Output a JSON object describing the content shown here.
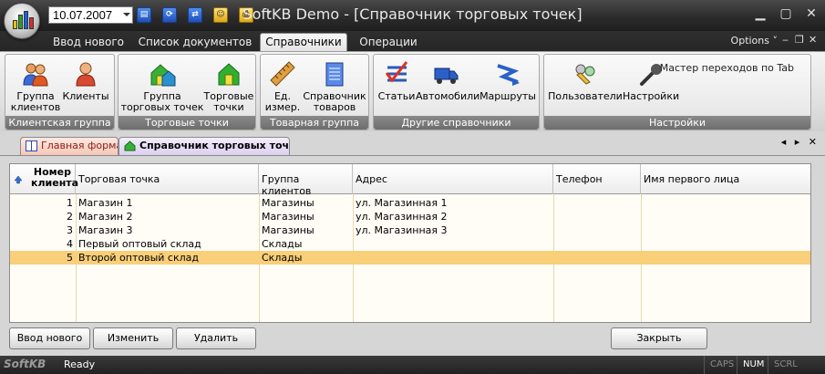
{
  "window": {
    "title": "SoftKB Demo - [Справочник торговых точек]",
    "date_value": "10.07.2007",
    "options_label": "Options",
    "options_chevron": "˅"
  },
  "quick_access": [
    {
      "name": "quick-access-list-icon",
      "glyph": "▤"
    },
    {
      "name": "quick-access-refresh-icon",
      "glyph": "⟳"
    },
    {
      "name": "quick-access-sync-icon",
      "glyph": "⇄"
    },
    {
      "name": "quick-access-users-icon",
      "glyph": "☺"
    },
    {
      "name": "quick-access-print-icon",
      "glyph": "⎙"
    }
  ],
  "ribbon_tabs": [
    "Ввод нового",
    "Список документов",
    "Справочники",
    "Операции"
  ],
  "ribbon": {
    "mastertab_label": "Мастер переходов по Tab",
    "groups": [
      {
        "label": "Клиентская группа",
        "buttons": [
          {
            "l1": "Группа",
            "l2": "клиентов"
          },
          {
            "l1": "Клиенты",
            "l2": ""
          }
        ]
      },
      {
        "label": "Торговые точки",
        "buttons": [
          {
            "l1": "Группа",
            "l2": "торговых точек"
          },
          {
            "l1": "Торговые",
            "l2": "точки"
          }
        ]
      },
      {
        "label": "Товарная группа",
        "buttons": [
          {
            "l1": "Ед.",
            "l2": "измер."
          },
          {
            "l1": "Справочник",
            "l2": "товаров"
          }
        ]
      },
      {
        "label": "Другие справочники",
        "buttons": [
          {
            "l1": "Статьи",
            "l2": ""
          },
          {
            "l1": "Автомобили",
            "l2": ""
          },
          {
            "l1": "Маршруты",
            "l2": ""
          }
        ]
      },
      {
        "label": "Настройки",
        "buttons": [
          {
            "l1": "Пользователи",
            "l2": ""
          },
          {
            "l1": "Настройки",
            "l2": ""
          }
        ]
      }
    ]
  },
  "doc_tabs": {
    "main_form": "Главная форма",
    "active": "Справочник торговых точек",
    "nav": "◂ ▸ ✕"
  },
  "table": {
    "headers": {
      "num": "Номер клиента",
      "point": "Торговая точка",
      "group": "Группа клиентов",
      "address": "Адрес",
      "phone": "Телефон",
      "person": "Имя первого лица"
    },
    "rows": [
      {
        "num": "1",
        "point": "Магазин 1",
        "group": "Магазины",
        "address": "ул. Магазинная 1",
        "phone": "",
        "person": ""
      },
      {
        "num": "2",
        "point": "Магазин 2",
        "group": "Магазины",
        "address": "ул. Магазинная 2",
        "phone": "",
        "person": ""
      },
      {
        "num": "3",
        "point": "Магазин 3",
        "group": "Магазины",
        "address": "ул. Магазинная 3",
        "phone": "",
        "person": ""
      },
      {
        "num": "4",
        "point": "Первый оптовый склад",
        "group": "Склады",
        "address": "",
        "phone": "",
        "person": ""
      },
      {
        "num": "5",
        "point": "Второй оптовый склад",
        "group": "Склады",
        "address": "",
        "phone": "",
        "person": ""
      }
    ],
    "selected_row": 5
  },
  "buttons": {
    "new": "Ввод нового",
    "edit": "Изменить",
    "delete": "Удалить",
    "close": "Закрыть"
  },
  "status": {
    "brand": "SoftKB",
    "text": "Ready",
    "caps": "CAPS",
    "num": "NUM",
    "scrl": "SCRL"
  },
  "colors": {
    "selected_row": "#f9cf7a",
    "grid_bg": "#fffdf6",
    "title_bar": "#2c2c2c"
  }
}
